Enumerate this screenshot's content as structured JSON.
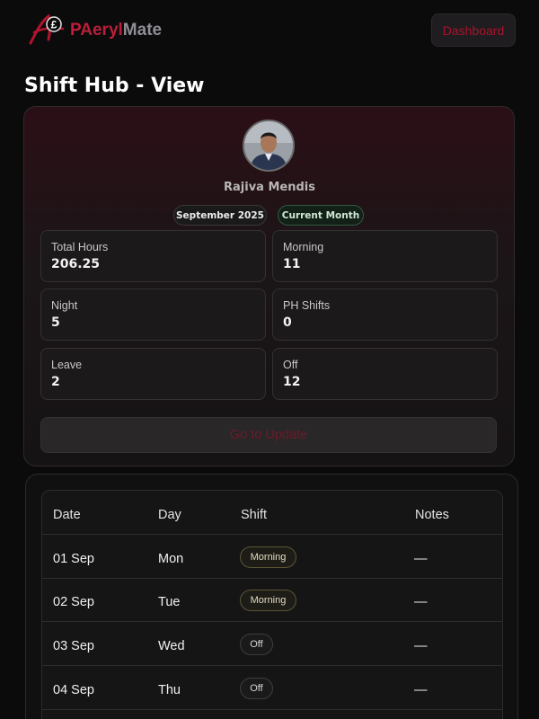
{
  "header": {
    "logo": {
      "part1": "P",
      "part2": "Aeryl",
      "part3": "Mate"
    },
    "dashboard_label": "Dashboard"
  },
  "page": {
    "title": "Shift Hub - View"
  },
  "profile": {
    "name": "Rajiva Mendis",
    "month_pill": "September 2025",
    "status_pill": "Current Month"
  },
  "stats": [
    {
      "label": "Total Hours",
      "value": "206.25"
    },
    {
      "label": "Morning",
      "value": "11"
    },
    {
      "label": "Night",
      "value": "5"
    },
    {
      "label": "PH Shifts",
      "value": "0"
    },
    {
      "label": "Leave",
      "value": "2"
    },
    {
      "label": "Off",
      "value": "12"
    }
  ],
  "goto_update_label": "Go to Update",
  "table": {
    "headers": {
      "date": "Date",
      "day": "Day",
      "shift": "Shift",
      "notes": "Notes"
    },
    "rows": [
      {
        "date": "01 Sep",
        "day": "Mon",
        "shift": "Morning",
        "notes": "—"
      },
      {
        "date": "02 Sep",
        "day": "Tue",
        "shift": "Morning",
        "notes": "—"
      },
      {
        "date": "03 Sep",
        "day": "Wed",
        "shift": "Off",
        "notes": "—"
      },
      {
        "date": "04 Sep",
        "day": "Thu",
        "shift": "Off",
        "notes": "—"
      }
    ]
  },
  "colors": {
    "accent": "#c31c3a",
    "background": "#0c0b0c",
    "card_gradient_top": "#2b0f16",
    "current_month_green": "#2f5a3e",
    "morning_badge_border": "#5a5635"
  }
}
